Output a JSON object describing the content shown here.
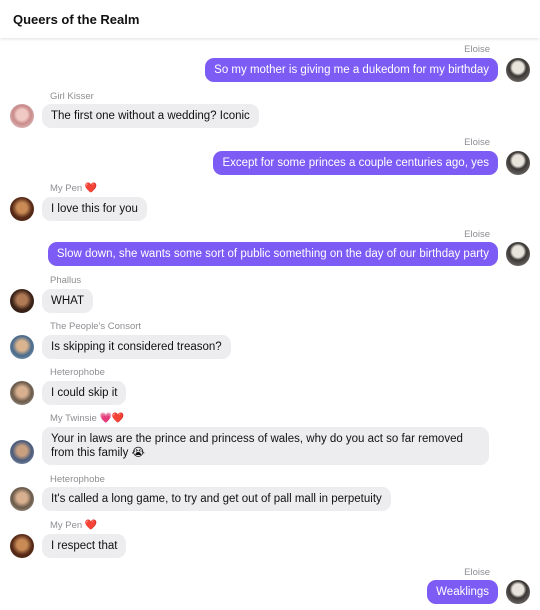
{
  "header": {
    "title": "Queers of the Realm"
  },
  "messages": [
    {
      "sender": "Eloise",
      "text": "So my mother is giving me a dukedom for my birthday",
      "outgoing": true
    },
    {
      "sender": "Girl Kisser",
      "text": "The first one without a wedding? Iconic",
      "outgoing": false
    },
    {
      "sender": "Eloise",
      "text": "Except for some princes a couple centuries ago, yes",
      "outgoing": true
    },
    {
      "sender": "My Pen",
      "sender_emoji": "❤️",
      "text": "I love this for you",
      "outgoing": false
    },
    {
      "sender": "Eloise",
      "text": "Slow down, she wants some sort of public something on the day of our birthday party",
      "outgoing": true
    },
    {
      "sender": "Phallus",
      "text": "WHAT",
      "outgoing": false
    },
    {
      "sender": "The People's Consort",
      "text": "Is skipping it considered treason?",
      "outgoing": false
    },
    {
      "sender": "Heterophobe",
      "text": "I could skip it",
      "outgoing": false
    },
    {
      "sender": "My Twinsie",
      "sender_emoji": "💗❤️",
      "text": "Your in laws are the prince and princess of wales, why do you act so far removed from this family 😭",
      "outgoing": false
    },
    {
      "sender": "Heterophobe",
      "text": "It's called a long game, to try and get out of pall mall in perpetuity",
      "outgoing": false
    },
    {
      "sender": "My Pen",
      "sender_emoji": "❤️",
      "text": "I respect that",
      "outgoing": false
    },
    {
      "sender": "Eloise",
      "text": "Weaklings",
      "outgoing": true
    }
  ],
  "colors": {
    "outgoing_bubble": "#7c5cf5",
    "incoming_bubble": "#ededf0",
    "sender_label": "#8e8e93"
  }
}
